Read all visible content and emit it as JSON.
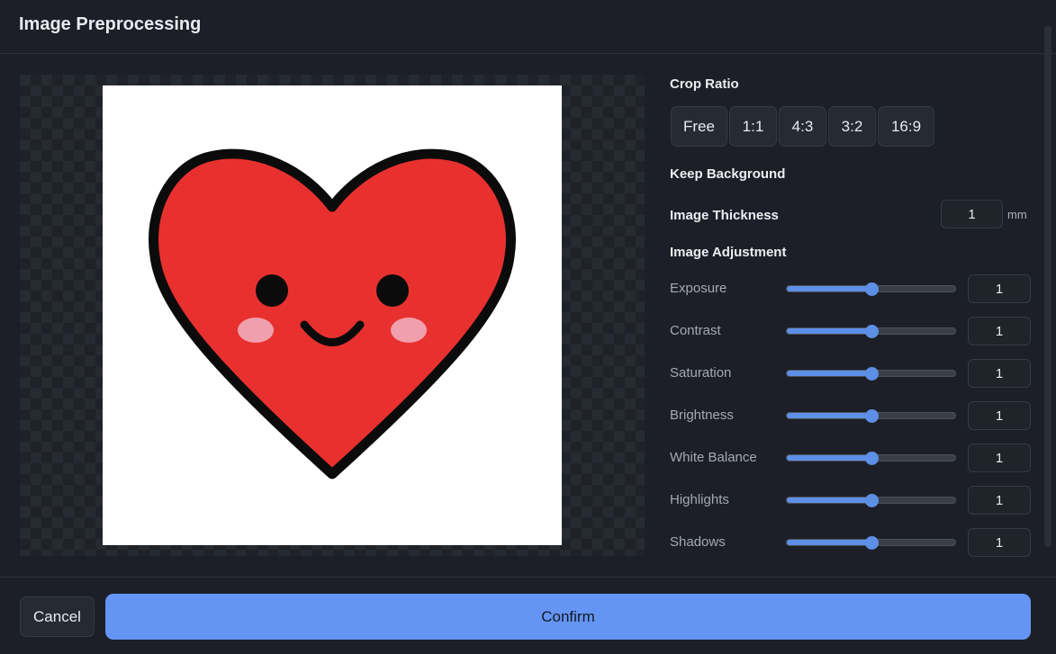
{
  "header": {
    "title": "Image Preprocessing"
  },
  "crop": {
    "label": "Crop Ratio",
    "options": [
      "Free",
      "1:1",
      "4:3",
      "3:2",
      "16:9"
    ]
  },
  "background": {
    "label": "Keep Background"
  },
  "thickness": {
    "label": "Image Thickness",
    "value": "1",
    "unit": "mm"
  },
  "adjustment": {
    "label": "Image Adjustment",
    "items": [
      {
        "label": "Exposure",
        "value": "1",
        "level": 0.5
      },
      {
        "label": "Contrast",
        "value": "1",
        "level": 0.5
      },
      {
        "label": "Saturation",
        "value": "1",
        "level": 0.5
      },
      {
        "label": "Brightness",
        "value": "1",
        "level": 0.5
      },
      {
        "label": "White Balance",
        "value": "1",
        "level": 0.5
      },
      {
        "label": "Highlights",
        "value": "1",
        "level": 0.5
      },
      {
        "label": "Shadows",
        "value": "1",
        "level": 0.5
      }
    ]
  },
  "footer": {
    "cancel_label": "Cancel",
    "confirm_label": "Confirm"
  },
  "colors": {
    "accent": "#6495f4",
    "heart": "#e8312f",
    "blush": "#f0a0ac"
  }
}
